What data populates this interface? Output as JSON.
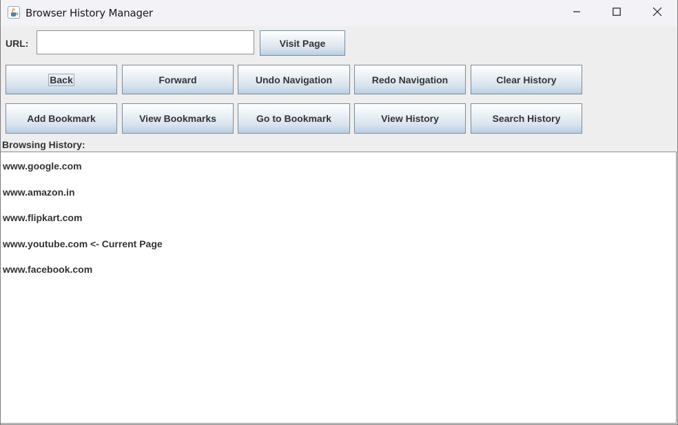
{
  "window": {
    "title": "Browser History Manager",
    "app_icon": "java-cup-icon",
    "controls": [
      "minimize-icon",
      "maximize-icon",
      "close-icon"
    ]
  },
  "url_bar": {
    "label": "URL:",
    "value": "",
    "visit_button": "Visit Page"
  },
  "nav_buttons": {
    "back": "Back",
    "forward": "Forward",
    "undo": "Undo Navigation",
    "redo": "Redo Navigation",
    "clear": "Clear History"
  },
  "action_buttons": {
    "add_bookmark": "Add Bookmark",
    "view_bookmarks": "View Bookmarks",
    "go_to_bookmark": "Go to Bookmark",
    "view_history": "View History",
    "search_history": "Search History"
  },
  "history": {
    "label": "Browsing History:",
    "entries": [
      "www.google.com",
      "www.amazon.in",
      "www.flipkart.com",
      "www.youtube.com <- Current Page",
      "www.facebook.com"
    ]
  },
  "colors": {
    "button_gradient_top": "#ffffff",
    "button_gradient_bottom": "#b8cfe5",
    "button_border": "#7a8a99",
    "text": "#333333",
    "background": "#eeeeee"
  }
}
